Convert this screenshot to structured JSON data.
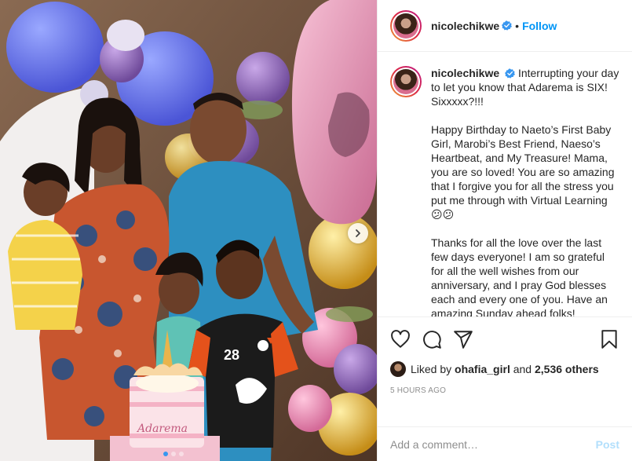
{
  "post": {
    "username": "nicolechikwe",
    "verified": true,
    "follow_label": "Follow",
    "separator": "•",
    "caption": {
      "username": "nicolechikwe",
      "lines": [
        "Interrupting your day to let you know that Adarema is SIX! Sixxxxx?!!!",
        "Happy Birthday to Naeto’s First Baby Girl, Marobi’s Best Friend, Naeso’s Heartbeat, and My Treasure! Mama, you are so loved! You are so amazing that I forgive you for all the stress you put me through with Virtual Learning 😕😕",
        "Thanks for all the love over the last few days everyone! I am so grateful for all the well wishes from our anniversary, and I pray God blesses each and every one of you. Have an amazing Sunday ahead folks!"
      ]
    },
    "likes": {
      "prefix": "Liked by",
      "user": "ohafia_girl",
      "conjunction": "and",
      "others": "2,536 others"
    },
    "timestamp": "5 HOURS AGO",
    "comment": {
      "placeholder": "Add a comment…",
      "post_label": "Post"
    },
    "carousel": {
      "slide_count": 3,
      "active_index": 0
    },
    "cake_text": "Adarema",
    "icons": [
      "heart-icon",
      "comment-icon",
      "share-icon",
      "bookmark-icon",
      "verified-badge-icon",
      "chevron-right-icon"
    ],
    "colors": {
      "link_blue": "#0095f6",
      "verified_blue": "#3897f0",
      "post_disabled": "#b2dffc",
      "muted": "#8e8e8e"
    }
  }
}
